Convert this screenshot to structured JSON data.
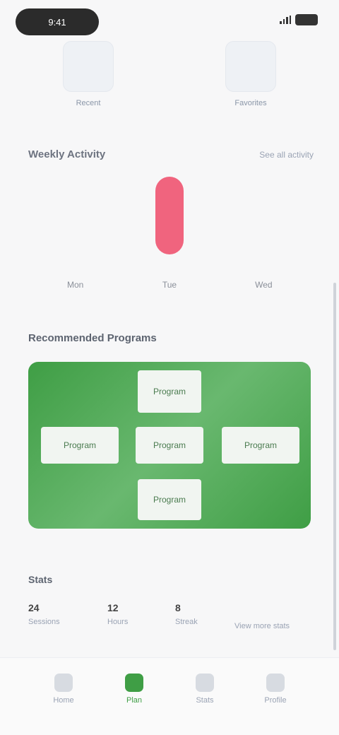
{
  "status": {
    "time": "9:41"
  },
  "top_cards": [
    {
      "caption": "Recent"
    },
    {
      "caption": "Favorites"
    }
  ],
  "activity": {
    "title": "Weekly Activity",
    "link": "See all activity"
  },
  "chart_data": {
    "type": "bar",
    "categories": [
      "Mon",
      "Tue",
      "Wed"
    ],
    "values": [
      0,
      100,
      0
    ],
    "colors": {
      "bar": "#f0647e"
    }
  },
  "banner": {
    "title": "Recommended Programs",
    "tiles": [
      "Program",
      "Program",
      "Program",
      "Program",
      "Program"
    ],
    "color": "#4fa655"
  },
  "stats": {
    "title": "Stats",
    "items": [
      {
        "value": "24",
        "label": "Sessions"
      },
      {
        "value": "12",
        "label": "Hours"
      },
      {
        "value": "8",
        "label": "Streak"
      }
    ],
    "link": "View more stats"
  },
  "tabs": [
    {
      "label": "Home",
      "icon": "home-icon"
    },
    {
      "label": "Plan",
      "icon": "plan-icon"
    },
    {
      "label": "Stats",
      "icon": "stats-icon"
    },
    {
      "label": "Profile",
      "icon": "profile-icon"
    }
  ],
  "accent": "#3f9e45"
}
